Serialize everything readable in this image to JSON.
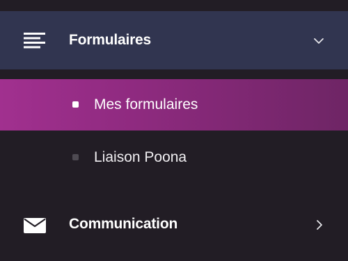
{
  "sidebar": {
    "group": {
      "label": "Formulaires",
      "icon": "menu-lines-icon",
      "expanded": true,
      "chevron": "chevron-down-icon"
    },
    "sub_items": [
      {
        "label": "Mes formulaires",
        "active": true,
        "icon": "bullet-icon"
      },
      {
        "label": "Liaison Poona",
        "active": false,
        "icon": "bullet-icon"
      }
    ],
    "communication": {
      "label": "Communication",
      "icon": "envelope-icon",
      "chevron": "chevron-right-icon"
    }
  },
  "colors": {
    "background": "#221d25",
    "group_header": "#313550",
    "active_gradient_start": "#a1308f",
    "active_gradient_end": "#6e2565",
    "text": "#ffffff"
  }
}
